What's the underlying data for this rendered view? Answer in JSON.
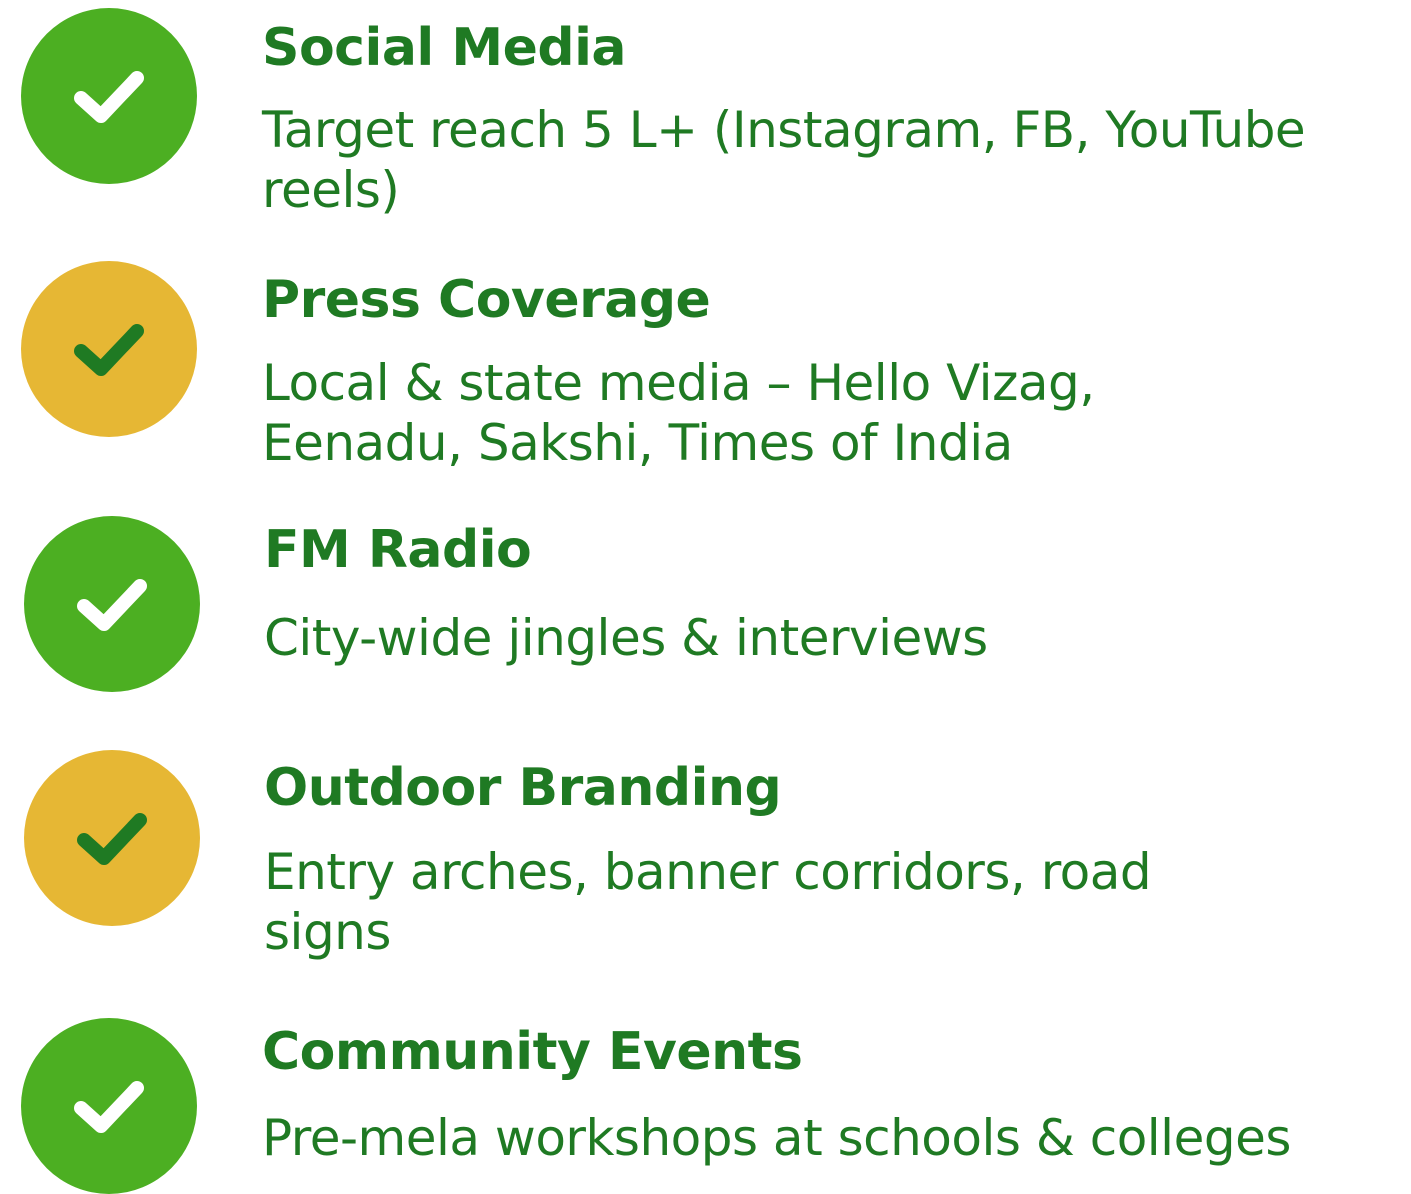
{
  "colors": {
    "green_badge": "#4caf22",
    "yellow_badge": "#e6b734",
    "text_green": "#1f7a23",
    "white_check": "#ffffff",
    "dark_check": "#1f7a23"
  },
  "items": [
    {
      "title": "Social Media",
      "description": "Target reach 5 L+ (Instagram, FB, YouTube reels)",
      "badge_color": "green",
      "icon": "check-icon"
    },
    {
      "title": "Press Coverage",
      "description": "Local & state media – Hello Vizag, Eenadu, Sakshi, Times of India",
      "badge_color": "yellow",
      "icon": "check-icon"
    },
    {
      "title": "FM Radio",
      "description": "City-wide jingles & interviews",
      "badge_color": "green",
      "icon": "check-icon"
    },
    {
      "title": "Outdoor Branding",
      "description": "Entry arches, banner corridors, road signs",
      "badge_color": "yellow",
      "icon": "check-icon"
    },
    {
      "title": "Community Events",
      "description": "Pre-mela workshops at schools & colleges",
      "badge_color": "green",
      "icon": "check-icon"
    }
  ]
}
